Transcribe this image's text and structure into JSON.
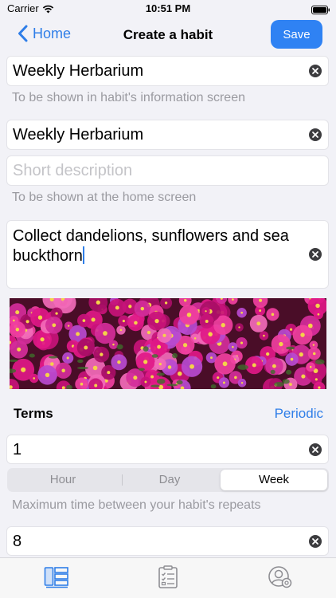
{
  "status_bar": {
    "carrier": "Carrier",
    "time": "10:51 PM"
  },
  "nav": {
    "back_label": "Home",
    "title": "Create a habit",
    "save_label": "Save"
  },
  "form": {
    "info_title": {
      "value": "Weekly Herbarium",
      "hint": "To be shown in habit's information screen"
    },
    "home_title": {
      "value": "Weekly Herbarium"
    },
    "short_description": {
      "placeholder": "Short description",
      "hint": "To be shown at the home screen"
    },
    "description": {
      "value": "Collect dandelions, sunflowers and sea buckthorn"
    },
    "terms": {
      "title": "Terms",
      "mode_link": "Periodic",
      "period_value": "1",
      "units": [
        "Hour",
        "Day",
        "Week"
      ],
      "selected_unit": "Week",
      "hint": "Maximum time between your habit's repeats",
      "second_value": "8"
    }
  },
  "tab_bar": {
    "icons": [
      "habits-list-icon",
      "checklist-icon",
      "profile-settings-icon"
    ],
    "selected": "habits-list-icon"
  },
  "colors": {
    "accent": "#2f7ee8",
    "save_button": "#2f82f3",
    "background": "#f2f2f7",
    "hint_text": "#9a9aa0"
  }
}
